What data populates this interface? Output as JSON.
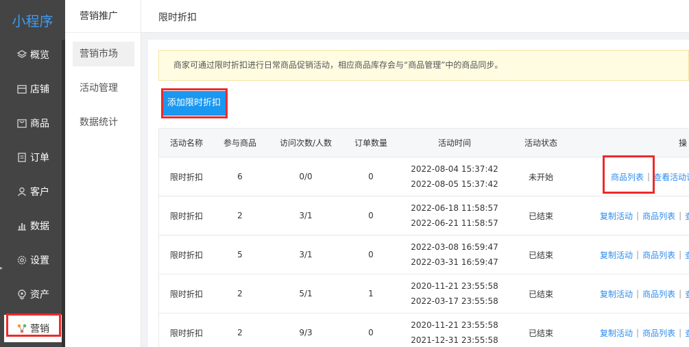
{
  "app": {
    "logo": "小程序"
  },
  "sidebar": {
    "items": [
      {
        "label": "概览",
        "icon": "layers-icon"
      },
      {
        "label": "店铺",
        "icon": "store-icon"
      },
      {
        "label": "商品",
        "icon": "bag-icon"
      },
      {
        "label": "订单",
        "icon": "order-icon"
      },
      {
        "label": "客户",
        "icon": "user-icon"
      },
      {
        "label": "数据",
        "icon": "chart-icon"
      },
      {
        "label": "设置",
        "icon": "gear-icon"
      },
      {
        "label": "资产",
        "icon": "asset-icon"
      },
      {
        "label": "营销",
        "icon": "marketing-icon",
        "active": true
      }
    ]
  },
  "submenu": {
    "title": "营销推广",
    "items": [
      "营销市场",
      "活动管理",
      "数据统计"
    ],
    "active": "营销市场"
  },
  "header": {
    "title": "限时折扣"
  },
  "notice": "商家可通过限时折扣进行日常商品促销活动，相应商品库存会与“商品管理”中的商品同步。",
  "add_button": "添加限时折扣",
  "table": {
    "columns": [
      "活动名称",
      "参与商品",
      "访问次数/人数",
      "订单数量",
      "活动时间",
      "活动状态",
      "操"
    ],
    "rows": [
      {
        "name": "限时折扣",
        "products": "6",
        "visits": "0/0",
        "orders": "0",
        "start": "2022-08-04 15:37:42",
        "end": "2022-08-05 15:37:42",
        "status": "未开始",
        "actions": [
          "商品列表",
          "查看活动详"
        ]
      },
      {
        "name": "限时折扣",
        "products": "2",
        "visits": "3/1",
        "orders": "0",
        "start": "2022-06-18 11:58:57",
        "end": "2022-06-21 11:58:57",
        "status": "已结束",
        "actions": [
          "复制活动",
          "商品列表",
          "查看"
        ]
      },
      {
        "name": "限时折扣",
        "products": "5",
        "visits": "3/1",
        "orders": "0",
        "start": "2022-03-08 16:59:47",
        "end": "2022-03-31 16:59:47",
        "status": "已结束",
        "actions": [
          "复制活动",
          "商品列表",
          "查看"
        ]
      },
      {
        "name": "限时折扣",
        "products": "2",
        "visits": "5/1",
        "orders": "1",
        "start": "2020-11-21 23:55:58",
        "end": "2022-03-17 23:55:58",
        "status": "已结束",
        "actions": [
          "复制活动",
          "商品列表",
          "查看"
        ]
      },
      {
        "name": "限时折扣",
        "products": "2",
        "visits": "9/3",
        "orders": "0",
        "start": "2020-11-21 23:55:58",
        "end": "2021-12-31 23:55:58",
        "status": "已结束",
        "actions": [
          "复制活动",
          "商品列表",
          "查看"
        ]
      }
    ]
  },
  "colors": {
    "sidebar_bg": "#444444",
    "accent": "#1a97f0",
    "link": "#2d8cf0",
    "highlight": "#ec2a2a",
    "notice_bg": "#fffce1"
  }
}
